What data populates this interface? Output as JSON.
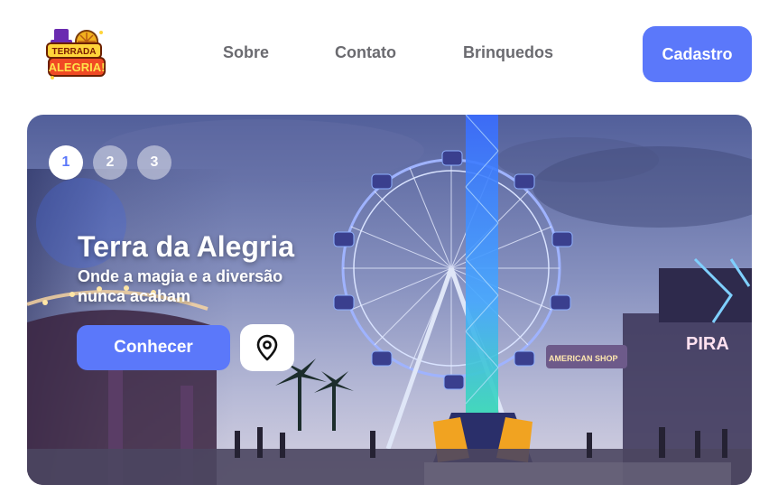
{
  "brand": {
    "logo_line1": "TERRADA",
    "logo_line2": "ALEGRIA!"
  },
  "nav": {
    "items": [
      "Sobre",
      "Contato",
      "Brinquedos"
    ],
    "cta_label": "Cadastro"
  },
  "hero": {
    "slides": [
      "1",
      "2",
      "3"
    ],
    "active_slide": 1,
    "title": "Terra da Alegria",
    "subtitle": "Onde a magia e a diversão nunca acabam",
    "primary_button": "Conhecer",
    "map_icon": "map-pin-icon",
    "sign_text": "PIRA",
    "sign_text_2": "AMERICAN SHOP"
  },
  "colors": {
    "accent": "#5b78fa",
    "nav_text": "#6b6b70",
    "background": "#ffffff"
  }
}
